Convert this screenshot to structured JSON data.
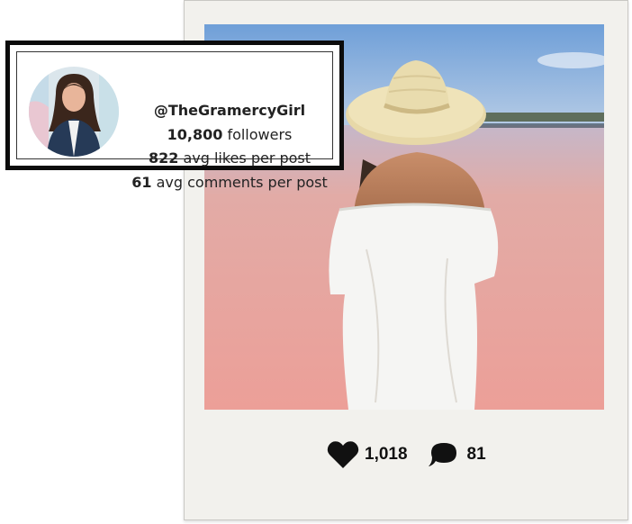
{
  "profile": {
    "handle": "@TheGramercyGirl",
    "followers_value": "10,800",
    "followers_label": "followers",
    "likes_value": "822",
    "likes_label": "avg likes per post",
    "comments_value": "61",
    "comments_label": "avg comments per post"
  },
  "post": {
    "likes": "1,018",
    "comments": "81"
  },
  "colors": {
    "card_border": "#0c0c0c",
    "polaroid_bg": "#f2f1ed",
    "sky": "#8fb2de",
    "pink_water": "#e6a9a1",
    "icon": "#111111"
  },
  "icons": {
    "likes": "heart-icon",
    "comments": "speech-bubble-icon"
  }
}
